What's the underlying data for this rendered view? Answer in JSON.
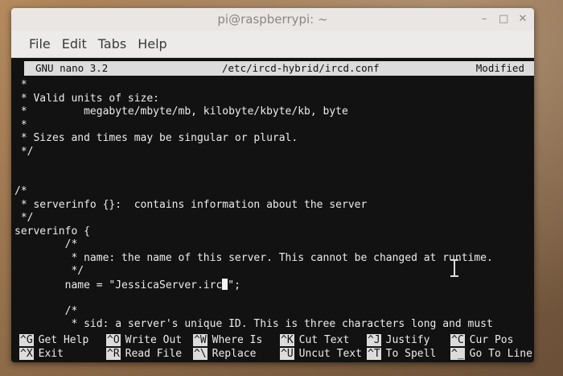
{
  "window": {
    "title": "pi@raspberrypi: ~",
    "controls": [
      "–",
      "□",
      "✕"
    ]
  },
  "menu": [
    "File",
    "Edit",
    "Tabs",
    "Help"
  ],
  "nano": {
    "version": "GNU nano 3.2",
    "filename": "/etc/ircd-hybrid/ircd.conf",
    "status": "Modified"
  },
  "lines": [
    " *",
    " * Valid units of size:",
    " *         megabyte/mbyte/mb, kilobyte/kbyte/kb, byte",
    " *",
    " * Sizes and times may be singular or plural.",
    " */",
    "",
    "",
    "/*",
    " * serverinfo {}:  contains information about the server",
    " */",
    "serverinfo {",
    "        /*",
    "         * name: the name of this server. This cannot be changed at runtime.",
    "         */",
    "        name = \"JessicaServer.irc",
    "",
    "        /*",
    "         * sid: a server's unique ID. This is three characters long and must"
  ],
  "cursor_line_tail": "\";",
  "shortcuts": {
    "row1": [
      {
        "key": "^G",
        "label": "Get Help"
      },
      {
        "key": "^O",
        "label": "Write Out"
      },
      {
        "key": "^W",
        "label": "Where Is"
      },
      {
        "key": "^K",
        "label": "Cut Text"
      },
      {
        "key": "^J",
        "label": "Justify"
      },
      {
        "key": "^C",
        "label": "Cur Pos"
      }
    ],
    "row2": [
      {
        "key": "^X",
        "label": "Exit"
      },
      {
        "key": "^R",
        "label": "Read File"
      },
      {
        "key": "^\\",
        "label": "Replace"
      },
      {
        "key": "^U",
        "label": "Uncut Text"
      },
      {
        "key": "^T",
        "label": "To Spell"
      },
      {
        "key": "^_",
        "label": "Go To Line"
      }
    ]
  }
}
